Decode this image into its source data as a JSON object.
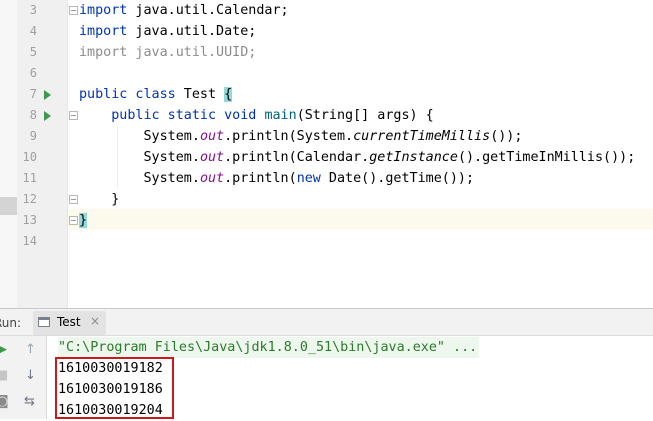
{
  "editor": {
    "lines": [
      {
        "num": "3",
        "text": "import java.util.Calendar;"
      },
      {
        "num": "4",
        "text": "import java.util.Date;"
      },
      {
        "num": "5",
        "text": "import java.util.UUID;"
      },
      {
        "num": "6",
        "text": ""
      },
      {
        "num": "7",
        "text": "public class Test {"
      },
      {
        "num": "8",
        "text": "    public static void main(String[] args) {"
      },
      {
        "num": "9",
        "text": "        System.out.println(System.currentTimeMillis());"
      },
      {
        "num": "10",
        "text": "        System.out.println(Calendar.getInstance().getTimeInMillis());"
      },
      {
        "num": "11",
        "text": "        System.out.println(new Date().getTime());"
      },
      {
        "num": "12",
        "text": "    }"
      },
      {
        "num": "13",
        "text": "}"
      },
      {
        "num": "14",
        "text": ""
      }
    ]
  },
  "run_panel": {
    "label": "Run:",
    "tab_label": "Test",
    "tab_close": "×",
    "command": "\"C:\\Program Files\\Java\\jdk1.8.0_51\\bin\\java.exe\" ...",
    "output": [
      "1610030019182",
      "1610030019186",
      "1610030019204"
    ],
    "tools": {
      "rerun_icon": "▶",
      "up_icon": "↑",
      "down_icon": "↓",
      "wrap_icon": "⇆",
      "stop_icon": "■",
      "camera_icon": "◙"
    }
  },
  "colors": {
    "keyword": "#0033b3",
    "field": "#871094",
    "run_green": "#3e9a4a",
    "highlight_box": "#cc1a1a"
  }
}
